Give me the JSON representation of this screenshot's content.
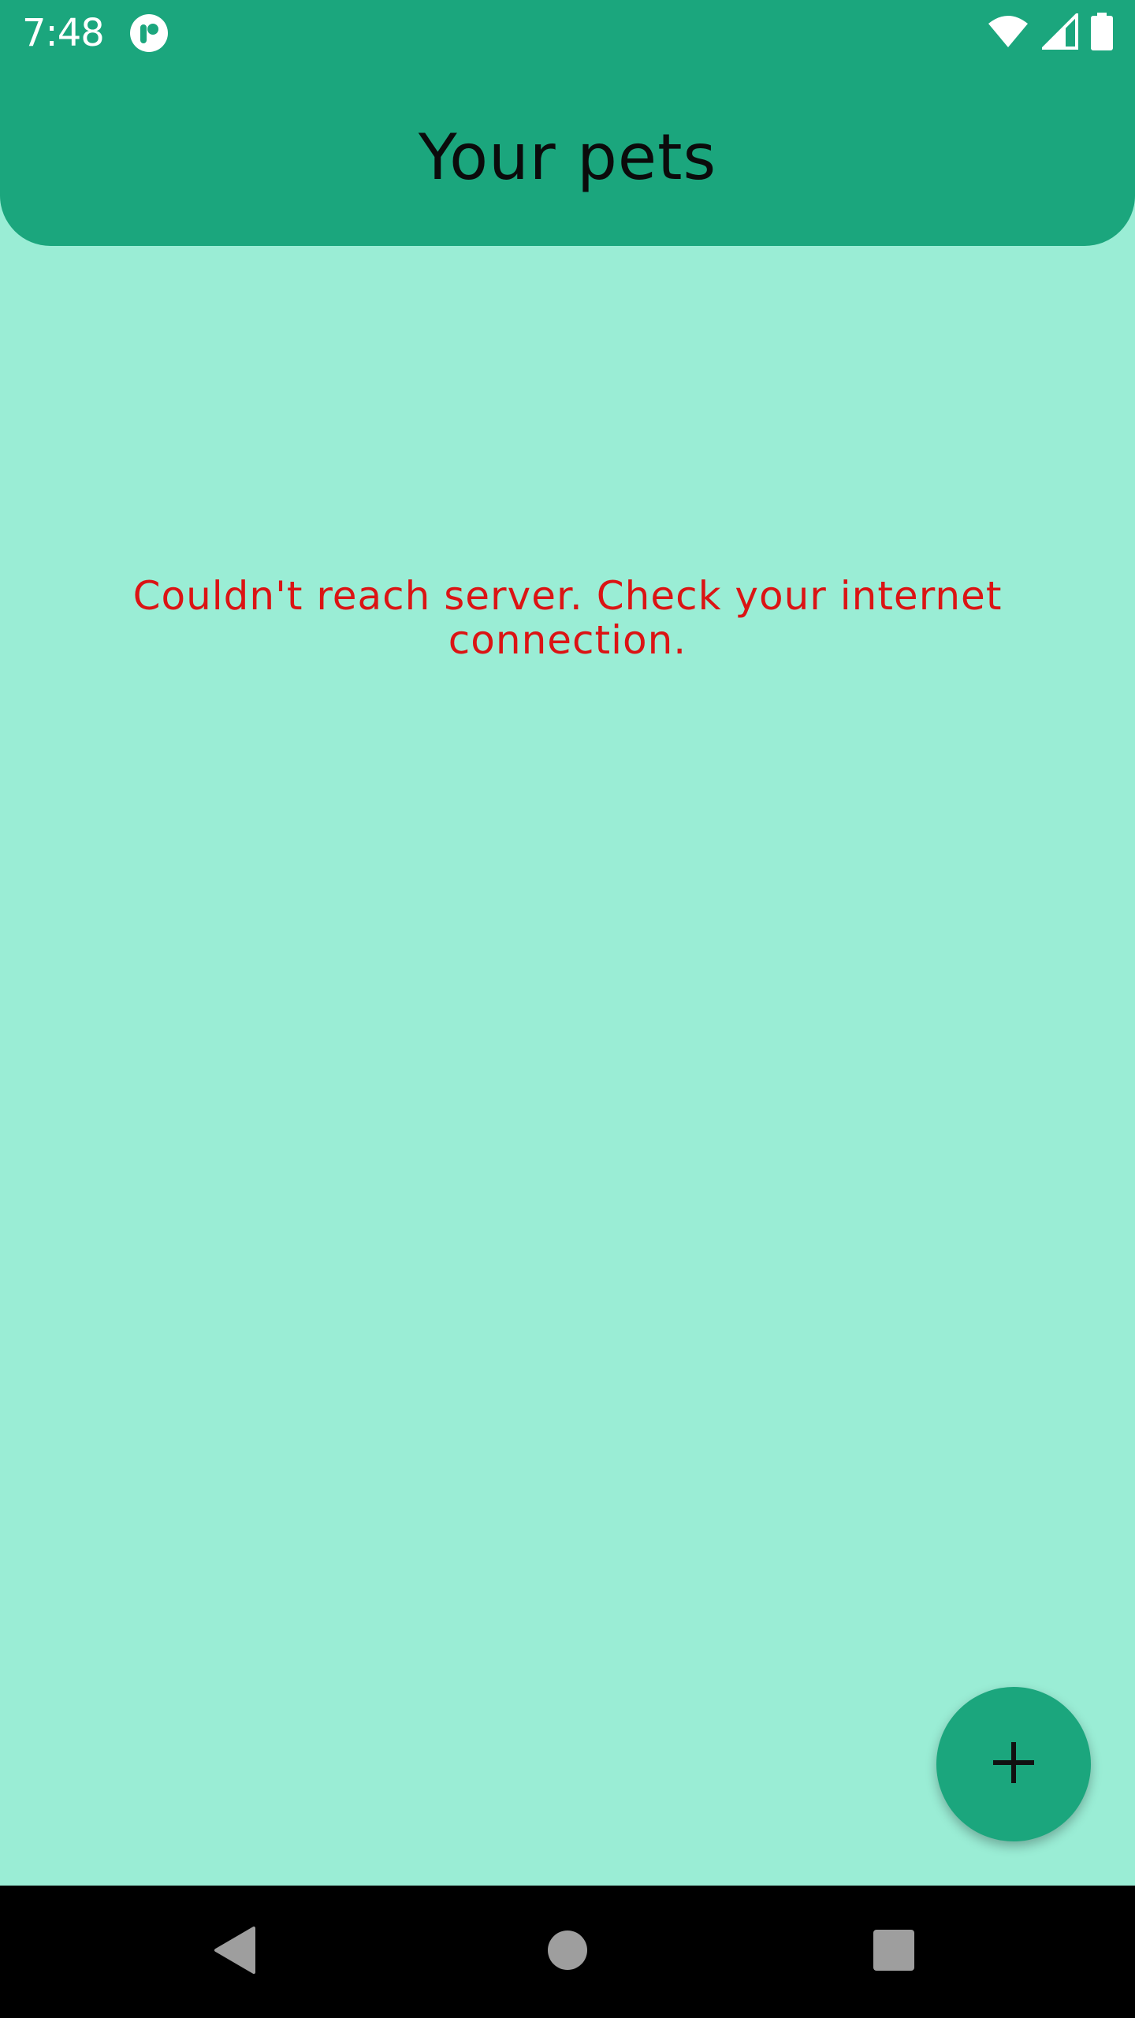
{
  "status_bar": {
    "time": "7:48",
    "icons": [
      "app-notification-icon",
      "wifi-icon",
      "cellular-signal-icon",
      "battery-icon"
    ]
  },
  "header": {
    "title": "Your pets"
  },
  "main": {
    "error_message": "Couldn't reach server. Check your internet connection."
  },
  "fab": {
    "icon": "plus-icon"
  },
  "nav_bar": {
    "buttons": [
      "back-icon",
      "home-icon",
      "recents-icon"
    ]
  },
  "colors": {
    "header_bg": "#1BA67D",
    "page_bg": "#9AEDD5",
    "error_text": "#DB1414",
    "fab_bg": "#1BA67D",
    "nav_bg": "#000000"
  }
}
